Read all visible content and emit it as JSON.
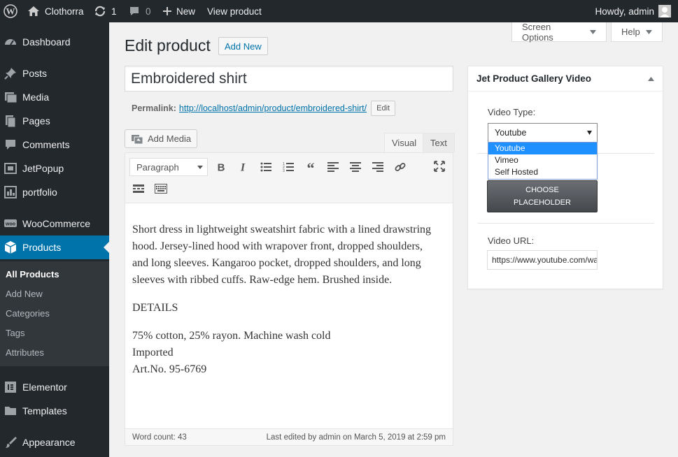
{
  "admin_bar": {
    "site_name": "Clothorra",
    "updates_count": "1",
    "comments_count": "0",
    "new_label": "New",
    "view_label": "View product",
    "howdy": "Howdy, admin"
  },
  "sidebar": {
    "items": [
      {
        "label": "Dashboard",
        "icon": "dashboard-icon"
      },
      {
        "label": "Posts",
        "icon": "pin-icon"
      },
      {
        "label": "Media",
        "icon": "media-icon"
      },
      {
        "label": "Pages",
        "icon": "pages-icon"
      },
      {
        "label": "Comments",
        "icon": "comment-icon"
      },
      {
        "label": "JetPopup",
        "icon": "popup-icon"
      },
      {
        "label": "portfolio",
        "icon": "portfolio-icon"
      },
      {
        "label": "WooCommerce",
        "icon": "woocommerce-icon"
      },
      {
        "label": "Products",
        "icon": "products-icon"
      },
      {
        "label": "Elementor",
        "icon": "elementor-icon"
      },
      {
        "label": "Templates",
        "icon": "folder-icon"
      },
      {
        "label": "Appearance",
        "icon": "brush-icon"
      }
    ],
    "submenu": [
      "All Products",
      "Add New",
      "Categories",
      "Tags",
      "Attributes"
    ]
  },
  "screen_options": "Screen Options",
  "help": "Help",
  "page": {
    "title": "Edit product",
    "add_new": "Add New",
    "product_title": "Embroidered shirt",
    "permalink_label": "Permalink:",
    "permalink_url": "http://localhost/admin/product/embroidered-shirt/",
    "permalink_edit": "Edit"
  },
  "editor": {
    "add_media": "Add Media",
    "tab_visual": "Visual",
    "tab_text": "Text",
    "format": "Paragraph",
    "content": [
      "Short dress in lightweight sweatshirt fabric with a lined drawstring hood. Jersey-lined hood with wrapover front, dropped shoulders, and long sleeves. Kangaroo pocket, dropped shoulders, and long sleeves with ribbed cuffs. Raw-edge hem. Brushed inside.",
      "DETAILS",
      "75% cotton, 25% rayon. Machine wash cold",
      "Imported",
      "Art.No. 95-6769"
    ],
    "word_count": "Word count: 43",
    "last_edited": "Last edited by admin on March 5, 2019 at 2:59 pm"
  },
  "metabox": {
    "title": "Jet Product Gallery Video",
    "video_type_label": "Video Type:",
    "video_type_value": "Youtube",
    "options": [
      "Youtube",
      "Vimeo",
      "Self Hosted"
    ],
    "choose_placeholder_line1": "CHOOSE",
    "choose_placeholder_line2": "PLACEHOLDER",
    "video_url_label": "Video URL:",
    "video_url_value": "https://www.youtube.com/watch"
  }
}
